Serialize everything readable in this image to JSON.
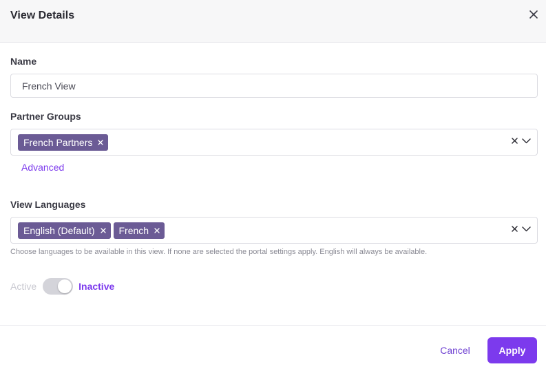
{
  "header": {
    "title": "View Details",
    "close_icon": "close-icon"
  },
  "name_field": {
    "label": "Name",
    "value": "French View"
  },
  "partner_groups": {
    "label": "Partner Groups",
    "chips": [
      {
        "label": "French Partners"
      }
    ],
    "clear_icon": "clear-icon",
    "dropdown_icon": "chevron-down-icon",
    "advanced_link": "Advanced"
  },
  "view_languages": {
    "label": "View Languages",
    "chips": [
      {
        "label": "English (Default)"
      },
      {
        "label": "French"
      }
    ],
    "clear_icon": "clear-icon",
    "dropdown_icon": "chevron-down-icon",
    "help_text": "Choose languages to be available in this view. If none are selected the portal settings apply. English will always be available."
  },
  "status_toggle": {
    "off_label": "Active",
    "on_label": "Inactive",
    "state": "inactive"
  },
  "footer": {
    "cancel_label": "Cancel",
    "apply_label": "Apply"
  },
  "colors": {
    "accent": "#7c3aed",
    "chip": "#6b5b95",
    "header_bg": "#f7f7f8",
    "toggle_track": "#d4d4da"
  }
}
